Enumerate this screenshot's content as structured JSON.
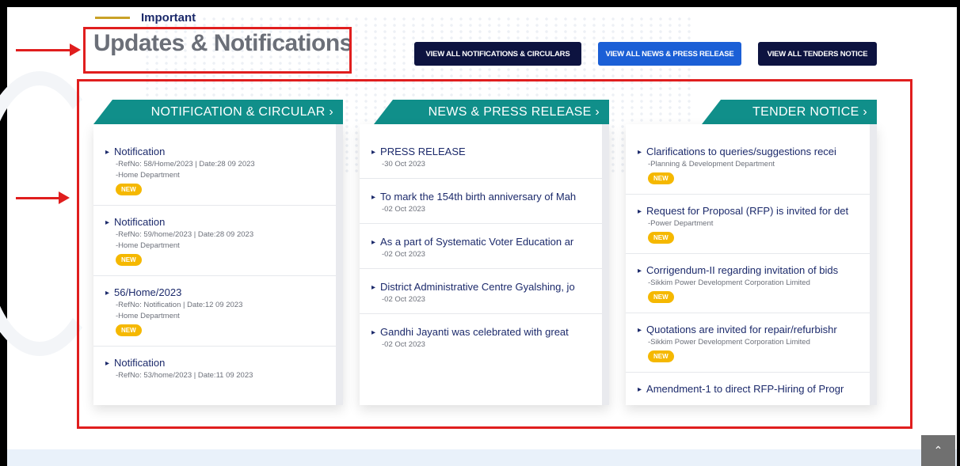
{
  "header": {
    "eyebrow": "Important",
    "title": "Updates & Notifications",
    "buttons": {
      "notifications": "VIEW ALL NOTIFICATIONS & CIRCULARS",
      "news": "VIEW ALL NEWS & PRESS RELEASE",
      "tenders": "VIEW ALL TENDERS NOTICE"
    }
  },
  "columns": {
    "notification": {
      "title": "NOTIFICATION & CIRCULAR ›",
      "items": [
        {
          "title": "Notification",
          "ref": "-RefNo: 58/Home/2023 | Date:28 09 2023",
          "dept": "-Home Department",
          "badge": "NEW"
        },
        {
          "title": "Notification",
          "ref": "-RefNo: 59/home/2023 | Date:28 09 2023",
          "dept": "-Home Department",
          "badge": "NEW"
        },
        {
          "title": "56/Home/2023",
          "ref": "-RefNo: Notification | Date:12 09 2023",
          "dept": "-Home Department",
          "badge": "NEW"
        },
        {
          "title": "Notification",
          "ref": "-RefNo: 53/home/2023 | Date:11 09 2023"
        }
      ]
    },
    "news": {
      "title": "NEWS & PRESS RELEASE ›",
      "items": [
        {
          "title": "PRESS RELEASE",
          "date": "-30 Oct 2023"
        },
        {
          "title": "To mark the 154th birth anniversary of Mah",
          "date": "-02 Oct 2023"
        },
        {
          "title": "As a part of Systematic Voter Education ar",
          "date": "-02 Oct 2023"
        },
        {
          "title": "District Administrative Centre Gyalshing, jo",
          "date": "-02 Oct 2023"
        },
        {
          "title": "Gandhi Jayanti was celebrated with great",
          "date": "-02 Oct 2023"
        }
      ]
    },
    "tender": {
      "title": "TENDER NOTICE ›",
      "items": [
        {
          "title": "Clarifications to queries/suggestions recei",
          "dept": "-Planning & Development Department",
          "badge": "NEW"
        },
        {
          "title": "Request for Proposal (RFP) is invited for det",
          "dept": "-Power Department",
          "badge": "NEW"
        },
        {
          "title": "Corrigendum-II regarding invitation of bids",
          "dept": "-Sikkim Power Development Corporation Limited",
          "badge": "NEW"
        },
        {
          "title": "Quotations are invited for repair/refurbishr",
          "dept": "-Sikkim Power Development Corporation Limited",
          "badge": "NEW"
        },
        {
          "title": "Amendment-1 to direct RFP-Hiring of Progr"
        }
      ]
    }
  },
  "colors": {
    "teal": "#108f8a",
    "navy": "#0d1340",
    "blue": "#1b5fd6",
    "badge": "#f5b800",
    "annotation_red": "#e01e1e"
  },
  "icons": {
    "item_bullet": "triangle-right-icon",
    "scroll_top": "chevron-up-icon"
  }
}
